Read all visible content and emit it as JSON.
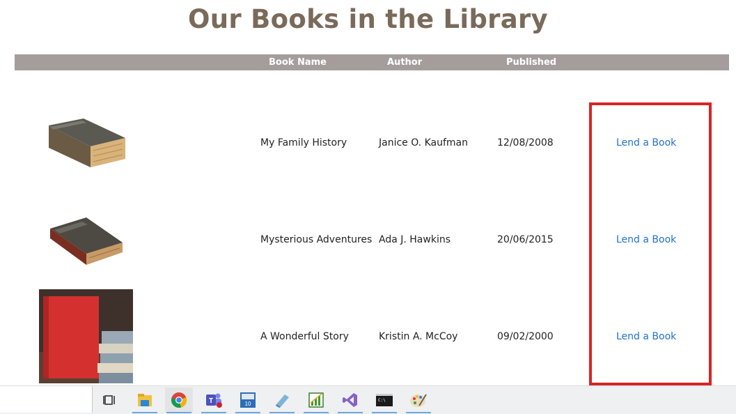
{
  "page": {
    "title": "Our Books in the Library"
  },
  "table": {
    "headers": {
      "book_name": "Book Name",
      "author": "Author",
      "published": "Published"
    },
    "rows": [
      {
        "book_name": "My Family History",
        "author": "Janice O. Kaufman",
        "published": "12/08/2008",
        "action": "Lend a Book",
        "cover": "old-brown-book-icon"
      },
      {
        "book_name": "Mysterious Adventures",
        "author": "Ada J. Hawkins",
        "published": "20/06/2015",
        "action": "Lend a Book",
        "cover": "old-leather-book-icon"
      },
      {
        "book_name": "A Wonderful Story",
        "author": "Kristin A. McCoy",
        "published": "09/02/2000",
        "action": "Lend a Book",
        "cover": "red-book-photo"
      }
    ]
  },
  "colors": {
    "title": "#7a6a5a",
    "header_bar": "#a59d9c",
    "link": "#2272c9",
    "highlight": "#d82424"
  },
  "taskbar": {
    "icons": [
      "task-view-icon",
      "file-explorer-icon",
      "chrome-icon",
      "teams-icon",
      "calculator-app-icon",
      "notepad-app-icon",
      "chart-app-icon",
      "visual-studio-icon",
      "terminal-icon",
      "paint-icon"
    ]
  }
}
